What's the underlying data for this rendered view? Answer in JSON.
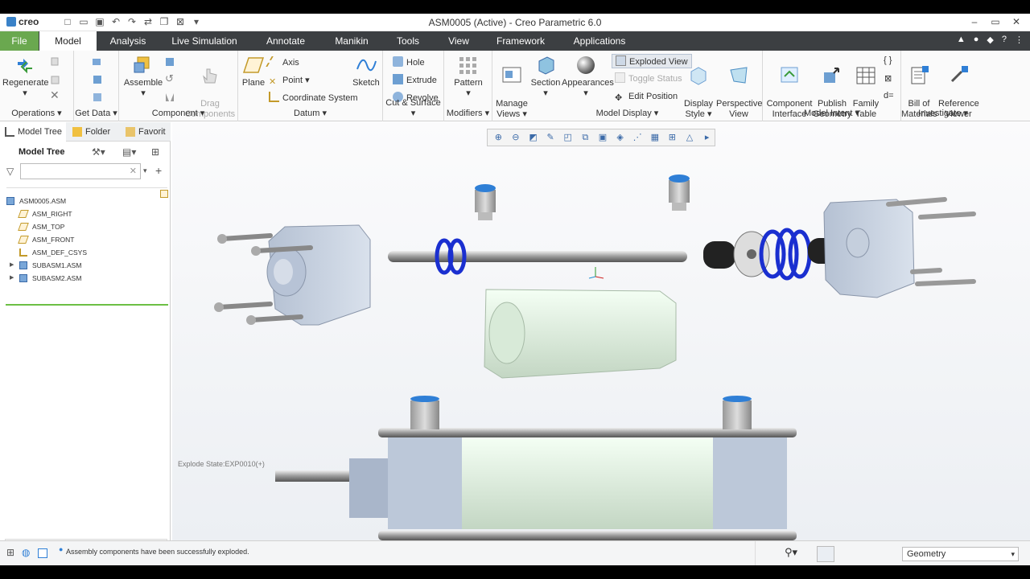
{
  "app": {
    "logo": "creo",
    "title": "ASM0005 (Active) - Creo Parametric 6.0"
  },
  "window_controls": [
    "–",
    "▭",
    "✕"
  ],
  "menu": {
    "file": "File",
    "tabs": [
      "Model",
      "Analysis",
      "Live Simulation",
      "Annotate",
      "Manikin",
      "Tools",
      "View",
      "Framework",
      "Applications"
    ],
    "active": "Model"
  },
  "ribbon": {
    "operations": {
      "regenerate": "Regenerate",
      "label": "Operations ▾"
    },
    "getdata": {
      "label": "Get Data ▾"
    },
    "component": {
      "assemble": "Assemble",
      "drag": "Drag\nComponents",
      "label": "Component ▾"
    },
    "datum": {
      "plane": "Plane",
      "axis": "Axis",
      "point": "Point",
      "csys": "Coordinate System",
      "sketch": "Sketch",
      "label": "Datum ▾"
    },
    "cut": {
      "hole": "Hole",
      "extrude": "Extrude",
      "revolve": "Revolve",
      "label": "Cut & Surface ▾"
    },
    "modifiers": {
      "pattern": "Pattern",
      "label": "Modifiers ▾"
    },
    "display": {
      "manage": "Manage\nViews",
      "section": "Section",
      "appearances": "Appearances",
      "exploded": "Exploded View",
      "toggle": "Toggle Status",
      "edit": "Edit Position",
      "style": "Display\nStyle",
      "perspective": "Perspective\nView",
      "label": "Model Display ▾"
    },
    "intent": {
      "interface": "Component\nInterface",
      "publish": "Publish\nGeometry",
      "family": "Family\nTable",
      "label": "Model Intent ▾"
    },
    "investigate": {
      "bom": "Bill of\nMaterials",
      "ref": "Reference\nViewer",
      "label": "Investigate ▾"
    }
  },
  "left": {
    "tabs": [
      "Model Tree",
      "Folder",
      "Favorit"
    ],
    "header": "Model Tree",
    "tree": [
      {
        "label": "ASM0005.ASM",
        "level": 0
      },
      {
        "label": "ASM_RIGHT",
        "level": 1
      },
      {
        "label": "ASM_TOP",
        "level": 1
      },
      {
        "label": "ASM_FRONT",
        "level": 1
      },
      {
        "label": "ASM_DEF_CSYS",
        "level": 1
      },
      {
        "label": "SUBASM1.ASM",
        "level": 1
      },
      {
        "label": "SUBASM2.ASM",
        "level": 1
      }
    ]
  },
  "graphics": {
    "explode_state": "Explode State:EXP0010(+)"
  },
  "status": {
    "message": "Assembly components have been successfully exploded.",
    "filter": "Geometry"
  },
  "colors": {
    "menubar": "#3c3f42",
    "file_tab": "#6aa84f",
    "tree_line": "#6cbf45",
    "body": "#c5d0de",
    "cylinder": "#cfe3cf",
    "fitting": "#2f7fd6",
    "spring": "#2233bb"
  }
}
